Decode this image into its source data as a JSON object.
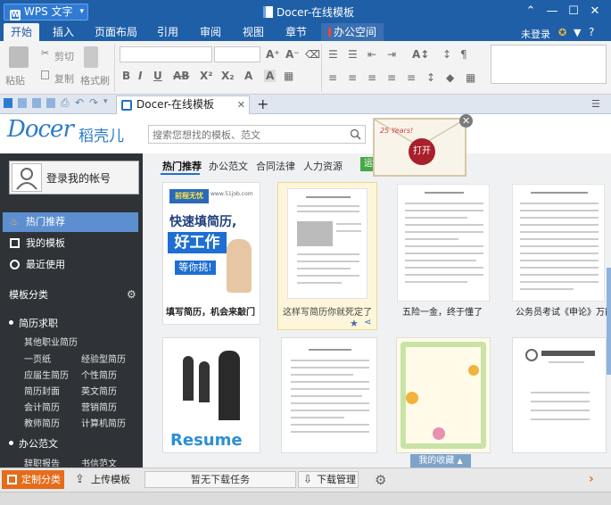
{
  "app": {
    "name": "WPS 文字",
    "document_title": "Docer-在线模板"
  },
  "menu": {
    "tabs": [
      "开始",
      "插入",
      "页面布局",
      "引用",
      "审阅",
      "视图",
      "章节",
      "办公空间"
    ],
    "login": "未登录"
  },
  "ribbon": {
    "paste": "粘贴",
    "cut": "剪切",
    "copy": "复制",
    "format_painter": "格式刷",
    "bold": "B",
    "italic": "I",
    "underline": "U",
    "strike": "AB",
    "superscript": "X²",
    "subscript": "X₂",
    "font_color": "A",
    "highlight": "A",
    "grow": "A⁺",
    "shrink": "A⁻"
  },
  "doc_tab": {
    "title": "Docer-在线模板"
  },
  "docer": {
    "logo": "Docer",
    "logo_cn": "稻壳儿",
    "search_placeholder": "搜索您想找的模板、范文"
  },
  "sidebar": {
    "login_label": "登录我的帐号",
    "nav": [
      {
        "label": "热门推荐",
        "icon": "flame-icon",
        "active": true
      },
      {
        "label": "我的模板",
        "icon": "template-icon",
        "active": false
      },
      {
        "label": "最近使用",
        "icon": "clock-icon",
        "active": false
      }
    ],
    "category_title": "模板分类",
    "groups": [
      {
        "label": "简历求职",
        "items": [
          "其他职业简历",
          "一页纸",
          "经验型简历",
          "应届生简历",
          "个性简历",
          "简历封面",
          "英文简历",
          "会计简历",
          "营销简历",
          "教师简历",
          "计算机简历"
        ]
      },
      {
        "label": "办公范文",
        "items": [
          "辞职报告",
          "书信范文"
        ]
      }
    ]
  },
  "content": {
    "tabs": [
      "热门推荐",
      "办公范文",
      "合同法律",
      "人力资源"
    ],
    "tab_more": "运",
    "cards": [
      {
        "title": "填写简历，机会来敲门",
        "bold": true,
        "cover_brand": "前程无忧",
        "cover_site": "www.51job.com",
        "cover_line1": "快速填简历,",
        "cover_line2": "好工作",
        "cover_line3": "等你挑!"
      },
      {
        "title": "这样写简历你就死定了"
      },
      {
        "title": "五险一金，终于懂了"
      },
      {
        "title": "公务员考试《申论》万能模板"
      },
      {
        "title": "",
        "cover_text": "Resume"
      },
      {
        "title": ""
      },
      {
        "title": ""
      },
      {
        "title": ""
      }
    ],
    "favorites": "我的收藏",
    "envelope_seal": "打开",
    "envelope_stamp": "25 Years!"
  },
  "bottom": {
    "custom_category": "定制分类",
    "upload": "上传模板",
    "download_status": "暂无下载任务",
    "download_manage": "下载管理"
  },
  "colors": {
    "title_blue": "#1e5fa8",
    "accent_orange": "#e56c1b",
    "sidebar_bg": "#2f3338",
    "nav_active": "#5d8fd0"
  }
}
